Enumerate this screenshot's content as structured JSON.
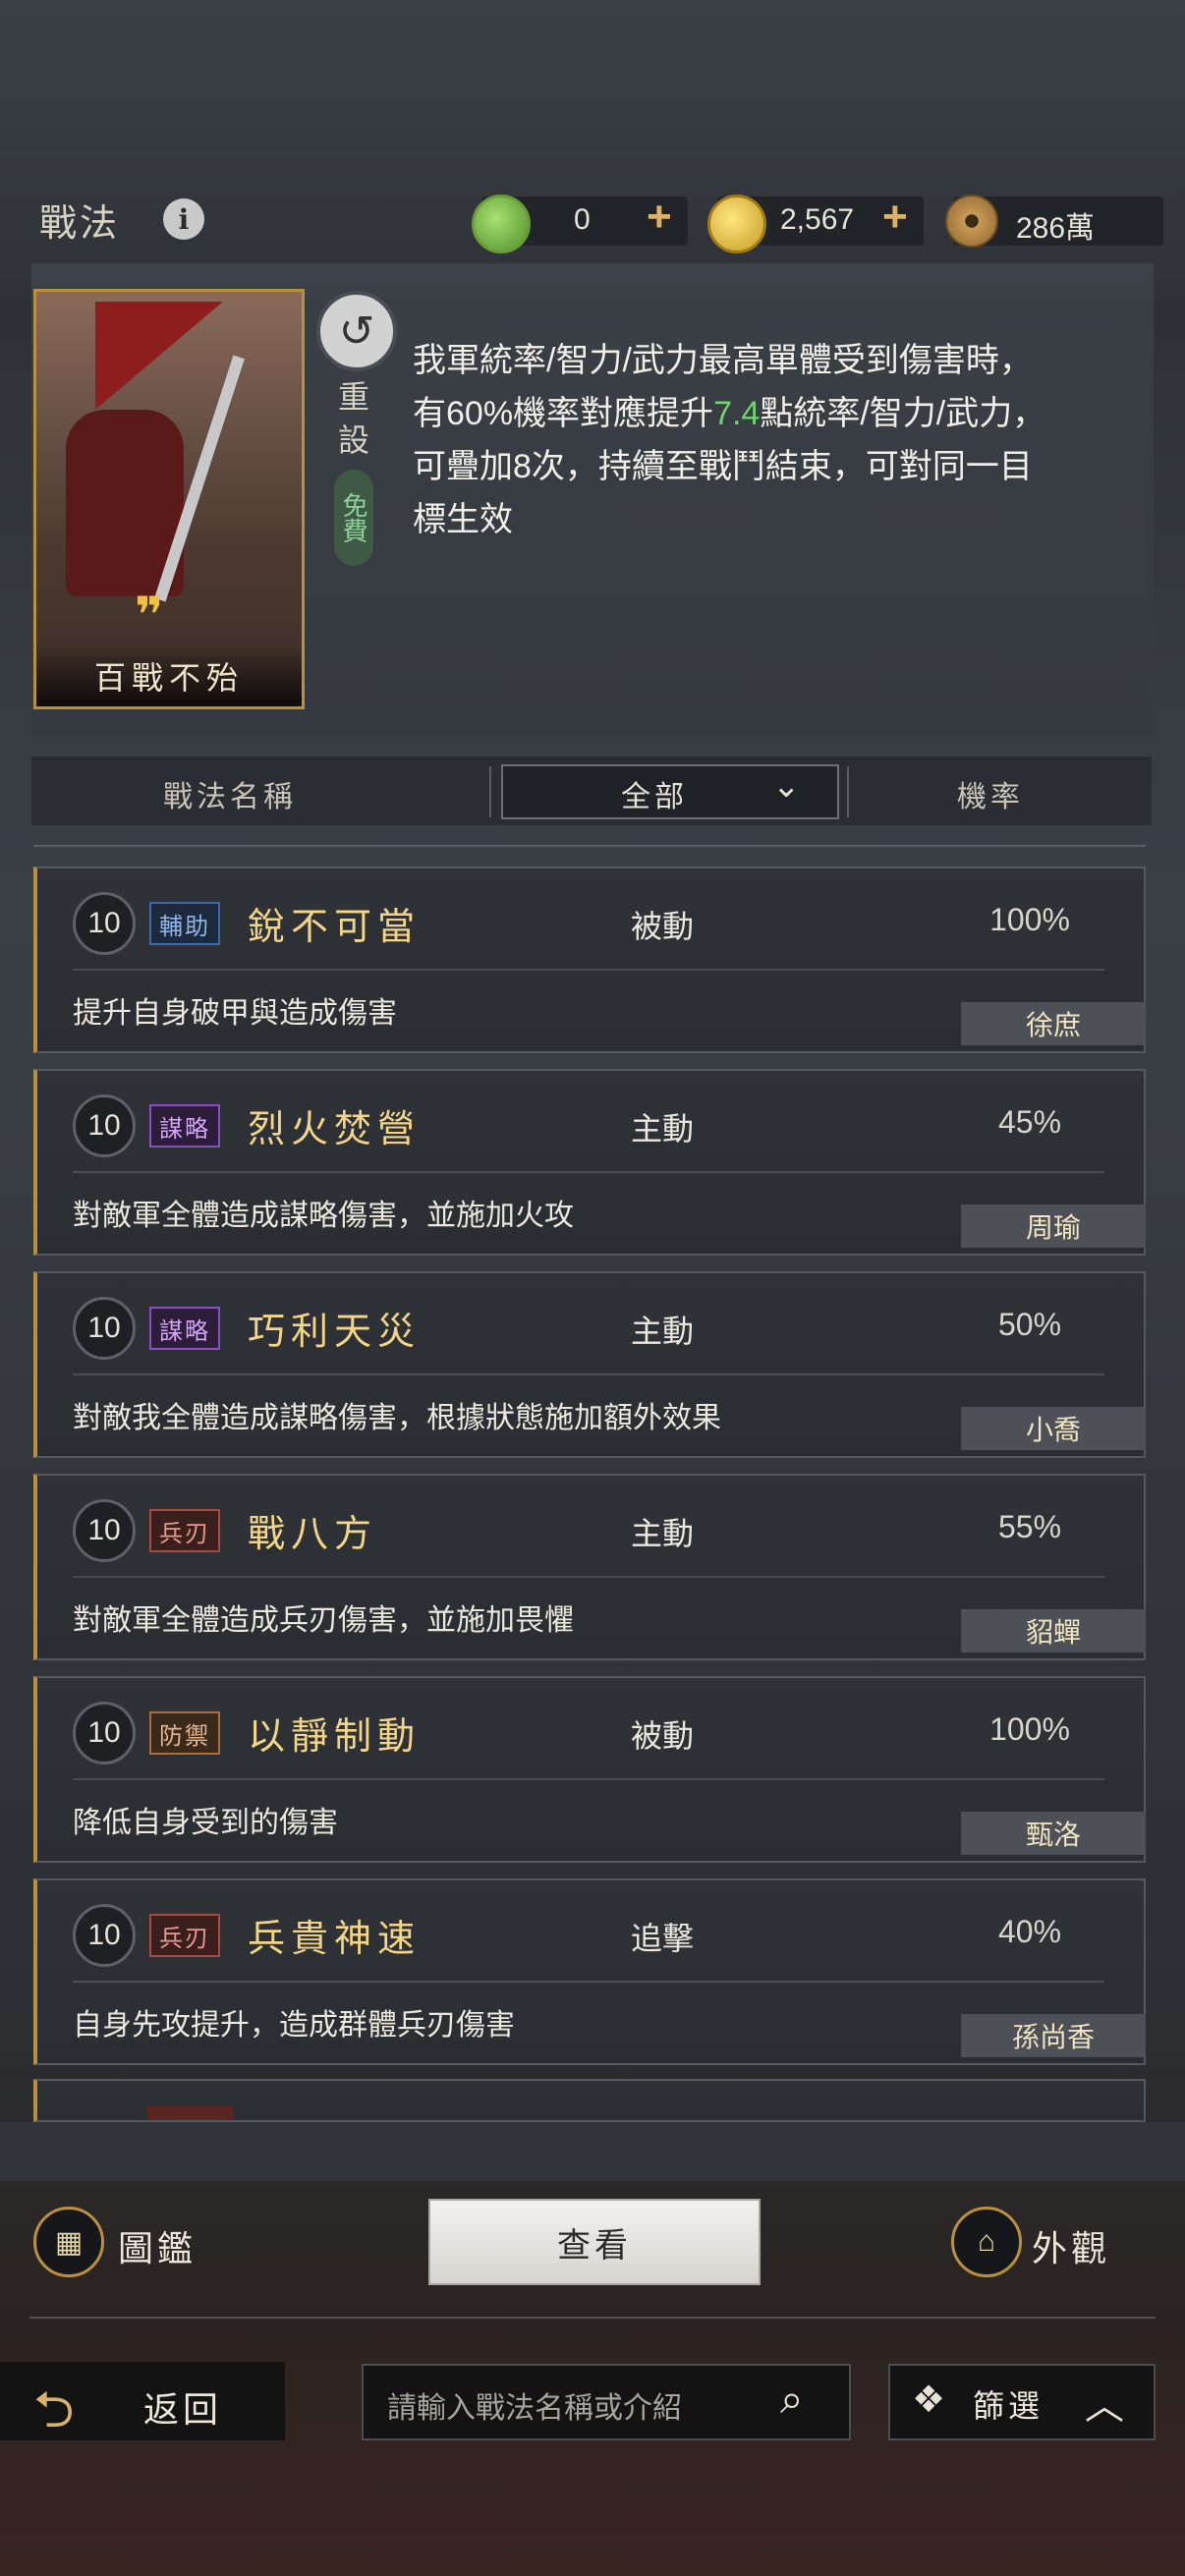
{
  "header": {
    "title": "戰法",
    "currencies": [
      {
        "icon": "jade-coin-icon",
        "value": "0",
        "has_plus": true
      },
      {
        "icon": "gold-coin-icon",
        "value": "2,567",
        "has_plus": true
      },
      {
        "icon": "copper-coin-icon",
        "value": "286萬",
        "has_plus": false
      }
    ]
  },
  "skill_card": {
    "name": "百戰不殆",
    "reset_label": "重設",
    "free_label": "免費",
    "description_part1": "我軍統率/智力/武力最高單體受到傷害時，有60%機率對應提升",
    "description_highlight": "7.4",
    "description_part2": "點統率/智力/武力，可疊加8次，持續至戰鬥結束，可對同一目標生效"
  },
  "table_header": {
    "col_name": "戰法名稱",
    "filter_value": "全部",
    "col_rate": "機率"
  },
  "skills": [
    {
      "level": "10",
      "tag": "輔助",
      "tag_type": "assist",
      "name": "銳不可當",
      "type": "被動",
      "rate": "100%",
      "desc": "提升自身破甲與造成傷害",
      "hero": "徐庶"
    },
    {
      "level": "10",
      "tag": "謀略",
      "tag_type": "strat",
      "name": "烈火焚營",
      "type": "主動",
      "rate": "45%",
      "desc": "對敵軍全體造成謀略傷害，並施加火攻",
      "hero": "周瑜"
    },
    {
      "level": "10",
      "tag": "謀略",
      "tag_type": "strat",
      "name": "巧利天災",
      "type": "主動",
      "rate": "50%",
      "desc": "對敵我全體造成謀略傷害，根據狀態施加額外效果",
      "hero": "小喬"
    },
    {
      "level": "10",
      "tag": "兵刃",
      "tag_type": "blade",
      "name": "戰八方",
      "type": "主動",
      "rate": "55%",
      "desc": "對敵軍全體造成兵刃傷害，並施加畏懼",
      "hero": "貂蟬"
    },
    {
      "level": "10",
      "tag": "防禦",
      "tag_type": "def",
      "name": "以靜制動",
      "type": "被動",
      "rate": "100%",
      "desc": "降低自身受到的傷害",
      "hero": "甄洛"
    },
    {
      "level": "10",
      "tag": "兵刃",
      "tag_type": "blade",
      "name": "兵貴神速",
      "type": "追擊",
      "rate": "40%",
      "desc": "自身先攻提升，造成群體兵刃傷害",
      "hero": "孫尚香"
    }
  ],
  "bottom": {
    "codex_label": "圖鑑",
    "view_label": "查看",
    "appearance_label": "外觀",
    "back_label": "返回",
    "search_placeholder": "請輸入戰法名稱或介紹",
    "filter_label": "篩選"
  },
  "colors": {
    "accent_gold": "#b8903f",
    "skill_name": "#f3d58a",
    "highlight_green": "#6fd46f"
  }
}
